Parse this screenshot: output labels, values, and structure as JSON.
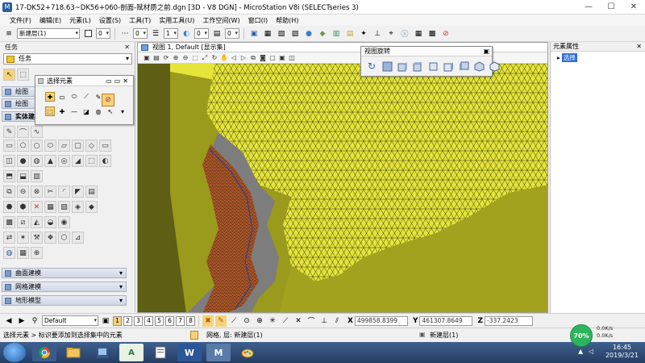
{
  "window": {
    "title": "17-DK52+718.63~DK56+060-剖面-赋材质之前.dgn [3D - V8 DGN] - MicroStation V8i (SELECTseries 3)",
    "controls": [
      "—",
      "☐",
      "✕"
    ]
  },
  "menu": [
    "文件(F)",
    "编辑(E)",
    "元素(L)",
    "设置(S)",
    "工具(T)",
    "实用工具(U)",
    "工作空间(W)",
    "窗口(I)",
    "帮助(H)"
  ],
  "toolbar": {
    "level": "新建层(1)",
    "color_value": "0",
    "line_style_value": "0",
    "weight_value": "1",
    "transparency_value": "0",
    "priority_value": "0"
  },
  "task_panel": {
    "title": "任务",
    "dropdown": "任务",
    "sections": [
      "绘图",
      "绘图",
      "实体建模"
    ],
    "bottom_sections": [
      "曲面建模",
      "网格建模",
      "地形模型"
    ]
  },
  "select_popup": {
    "title": "选择元素"
  },
  "view": {
    "title": "视图 1, Default [显示集]"
  },
  "rotation_popup": {
    "title": "视图旋转"
  },
  "properties": {
    "title": "元素属性",
    "selected": "选择"
  },
  "viewbar": {
    "view_attr": "Default",
    "view_numbers": [
      "1",
      "2",
      "3",
      "4",
      "5",
      "6",
      "7",
      "8"
    ],
    "active_view": "1",
    "x_label": "X",
    "x_value": "499858.8399",
    "y_label": "Y",
    "y_value": "461307.8649",
    "z_label": "Z",
    "z_value": "-337.2423"
  },
  "status": {
    "prompt": "选择元素 > 标识要添加到选择集中的元素",
    "level_text": "网格, 层: 新建层(1)",
    "level_right": "新建层(1)"
  },
  "taskbar": {
    "network_percent": "70%",
    "upload": "0.0K/s",
    "download": "0.0K/s",
    "time": "16:45",
    "date": "2019/3/21"
  },
  "colors": {
    "mesh_yellow": "#e5e43a",
    "rock_face": "#9a9a1c",
    "shadow_face": "#5e5e14",
    "brown_mesh": "#a9572a",
    "selection_blue": "#2f6fd6"
  }
}
